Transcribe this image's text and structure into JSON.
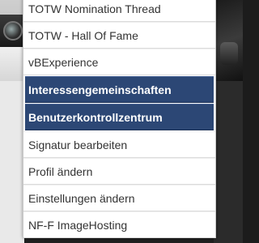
{
  "colors": {
    "menu_background": "#ffffff",
    "menu_text": "#333333",
    "highlight_background": "#2c4775",
    "highlight_text": "#ffffff"
  },
  "menu": {
    "items": [
      {
        "label": "TOTW Nomination Thread",
        "highlighted": false
      },
      {
        "label": "TOTW - Hall Of Fame",
        "highlighted": false
      },
      {
        "label": "vBExperience",
        "highlighted": false
      },
      {
        "label": "Interessengemeinschaften",
        "highlighted": true
      },
      {
        "label": "Benutzerkontrollzentrum",
        "highlighted": true
      },
      {
        "label": "Signatur bearbeiten",
        "highlighted": false
      },
      {
        "label": "Profil ändern",
        "highlighted": false
      },
      {
        "label": "Einstellungen ändern",
        "highlighted": false
      },
      {
        "label": "NF-F ImageHosting",
        "highlighted": false
      }
    ]
  }
}
